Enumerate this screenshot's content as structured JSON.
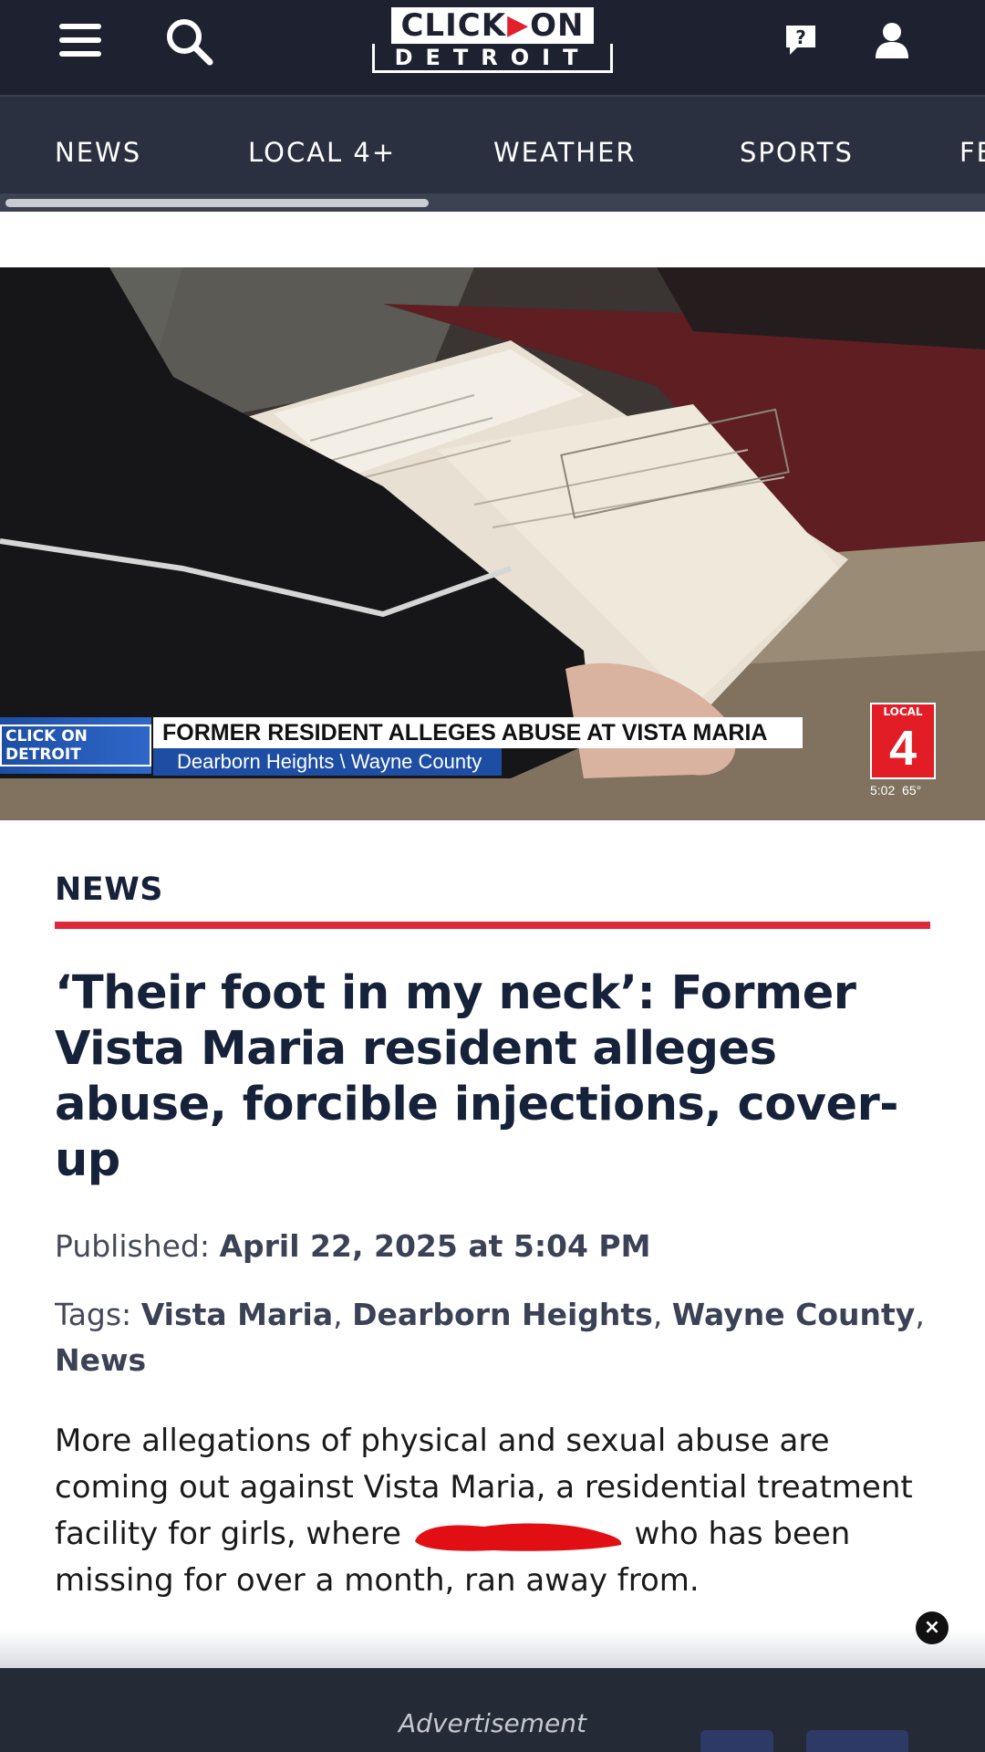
{
  "header": {
    "logo_top_left": "CLICK",
    "logo_top_right": "ON",
    "logo_bottom": "DETROIT",
    "icons": [
      "menu-icon",
      "search-icon",
      "chat-help-icon",
      "user-icon"
    ]
  },
  "nav": {
    "items": [
      {
        "label": "NEWS"
      },
      {
        "label": "LOCAL 4+"
      },
      {
        "label": "WEATHER"
      },
      {
        "label": "SPORTS"
      },
      {
        "label": "FE"
      }
    ]
  },
  "video": {
    "lower_third_logo": "CLICK ON DETROIT",
    "headline": "FORMER RESIDENT ALLEGES ABUSE AT VISTA MARIA",
    "location": "Dearborn Heights \\ Wayne County",
    "bug_local": "LOCAL",
    "bug_number": "4",
    "time": "5:02",
    "temperature": "65°"
  },
  "article": {
    "section": "NEWS",
    "headline": "‘Their foot in my neck’: Former Vista Maria resident alleges abuse, forcible injections, cover-up",
    "published_label": "Published:",
    "published_value": "April 22, 2025 at 5:04 PM",
    "tags_label": "Tags:",
    "tags": [
      "Vista Maria",
      "Dearborn Heights",
      "Wayne County",
      "News"
    ],
    "body_before": "More allegations of physical and sexual abuse are coming out against Vista Maria, a residential treatment facility for girls, where",
    "body_after": "who has been missing for over a month, ran away from."
  },
  "ad": {
    "label": "Advertisement",
    "close": "×"
  },
  "colors": {
    "header_bg": "#1e2230",
    "nav_bg": "#2b3040",
    "accent_red": "#e0283b",
    "text_dark": "#16213a"
  }
}
